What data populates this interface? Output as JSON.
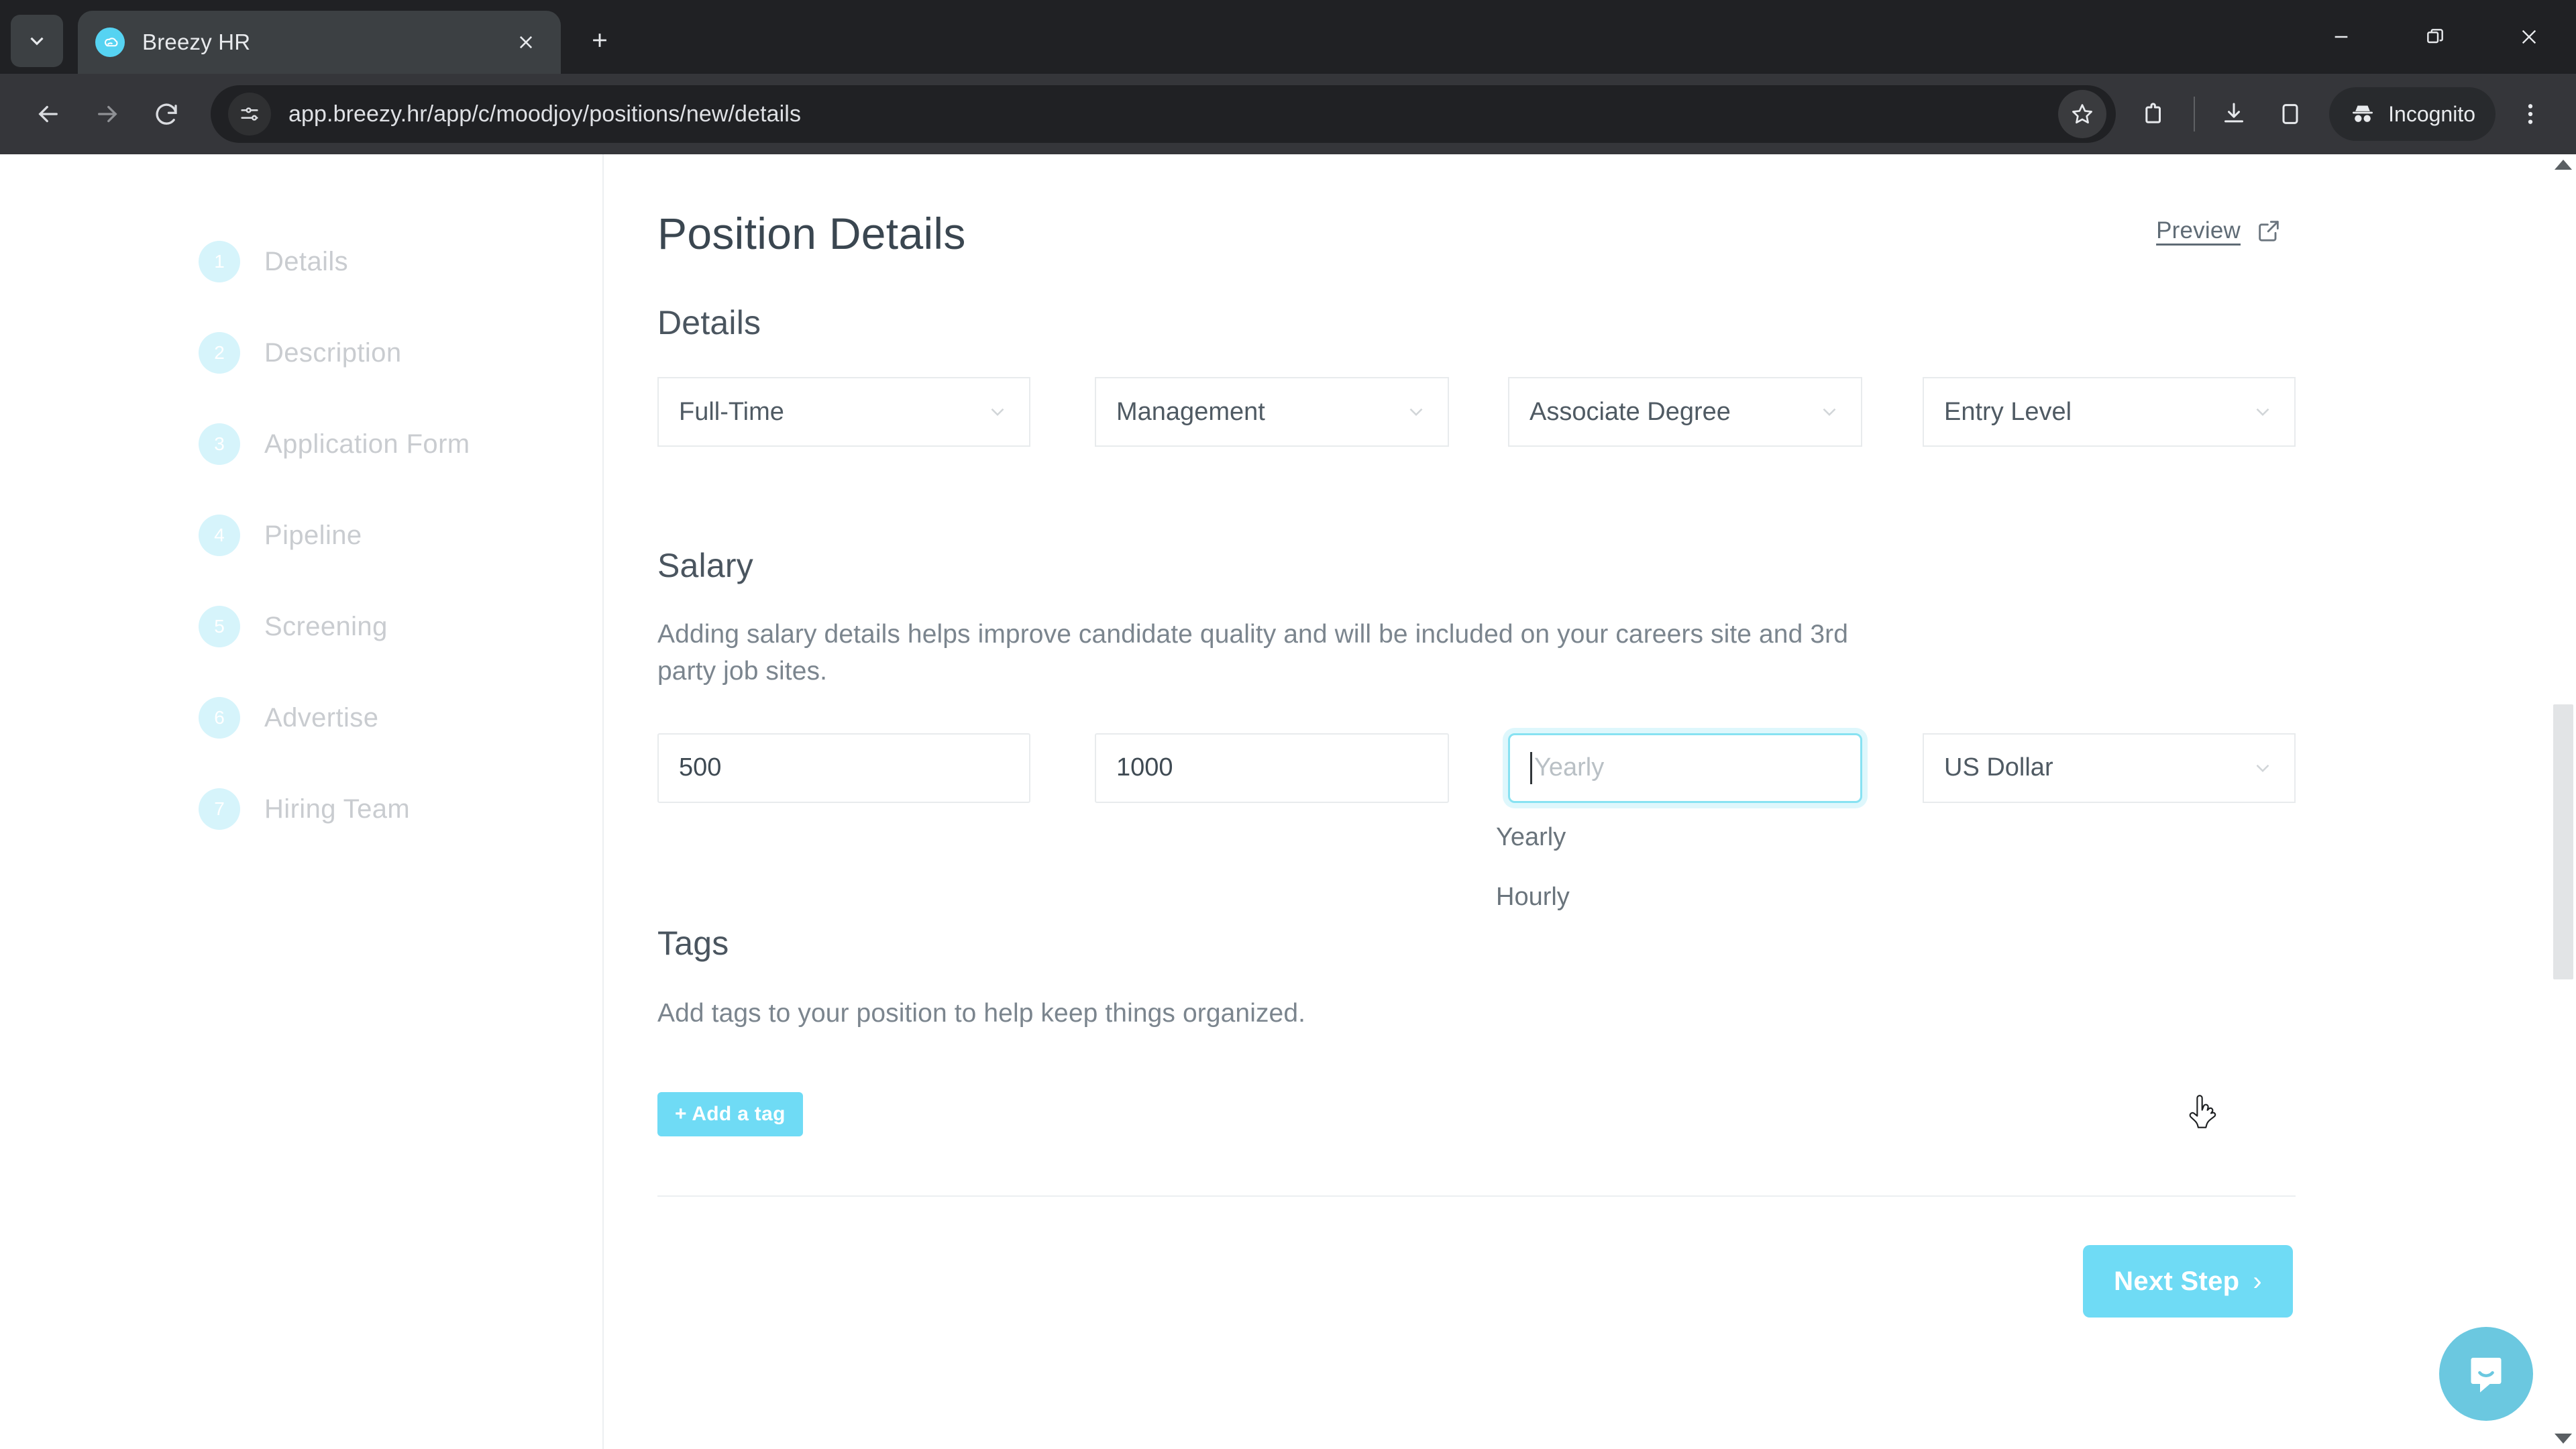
{
  "browser": {
    "tab": {
      "title": "Breezy HR",
      "favicon_icon": "breezy-logo-icon"
    },
    "new_tab_label": "+",
    "url": "app.breezy.hr/app/c/moodjoy/positions/new/details",
    "profile_label": "Incognito",
    "icons": {
      "tab_search": "chevron-down-icon",
      "close_tab": "close-icon",
      "back": "back-arrow-icon",
      "forward": "forward-arrow-icon",
      "reload": "reload-icon",
      "site_info": "site-settings-icon",
      "bookmark": "star-icon",
      "extensions": "extensions-icon",
      "downloads": "download-icon",
      "side_panel": "side-panel-icon",
      "incognito": "incognito-icon",
      "menu": "three-dot-menu-icon",
      "minimize": "minimize-icon",
      "maximize": "restore-icon",
      "close_window": "window-close-icon"
    }
  },
  "steps": [
    {
      "num": "1",
      "label": "Details"
    },
    {
      "num": "2",
      "label": "Description"
    },
    {
      "num": "3",
      "label": "Application Form"
    },
    {
      "num": "4",
      "label": "Pipeline"
    },
    {
      "num": "5",
      "label": "Screening"
    },
    {
      "num": "6",
      "label": "Advertise"
    },
    {
      "num": "7",
      "label": "Hiring Team"
    }
  ],
  "header": {
    "title": "Position Details",
    "preview_label": "Preview",
    "preview_icon": "external-link-icon"
  },
  "details": {
    "heading": "Details",
    "selects": [
      {
        "value": "Full-Time"
      },
      {
        "value": "Management"
      },
      {
        "value": "Associate Degree"
      },
      {
        "value": "Entry Level"
      }
    ]
  },
  "salary": {
    "heading": "Salary",
    "description": "Adding salary details helps improve candidate quality and will be included on your careers site and 3rd party job sites.",
    "min_value": "500",
    "max_value": "1000",
    "period_placeholder": "Yearly",
    "period_value": "",
    "period_options": [
      "Yearly",
      "Hourly"
    ],
    "currency_value": "US Dollar"
  },
  "tags": {
    "heading": "Tags",
    "description": "Add tags to your position to help keep things organized.",
    "add_label": "+ Add a tag"
  },
  "footer": {
    "next_label": "Next Step",
    "next_chevron": "›"
  },
  "support": {
    "icon": "intercom-chat-icon"
  },
  "colors": {
    "accent": "#6fdbf5",
    "focus_border": "#87e2f2",
    "step_circle": "#d6f4fb",
    "intercom": "#6bc8e0"
  }
}
